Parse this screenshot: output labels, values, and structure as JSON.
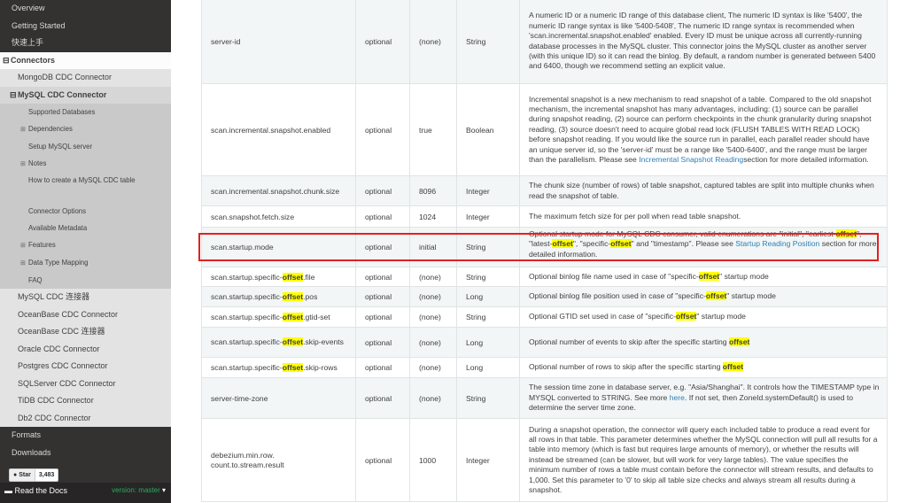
{
  "sidebar": {
    "top_items": [
      "Overview",
      "Getting Started",
      "快速上手"
    ],
    "section_label": "Connectors",
    "connector_mongodb": "MongoDB CDC Connector",
    "connector_mysql": "MySQL CDC Connector",
    "mysql_sub": [
      "Supported Databases",
      "Dependencies",
      "Setup MySQL server",
      "Notes",
      "How to create a MySQL CDC table",
      "Connector Options",
      "Available Metadata",
      "Features",
      "Data Type Mapping",
      "FAQ"
    ],
    "other_connectors": [
      "MySQL CDC 连接器",
      "OceanBase CDC Connector",
      "OceanBase CDC 连接器",
      "Oracle CDC Connector",
      "Postgres CDC Connector",
      "SQLServer CDC Connector",
      "TiDB CDC Connector",
      "Db2 CDC Connector"
    ],
    "bottom_items": [
      "Formats",
      "Downloads"
    ]
  },
  "github": {
    "star_label": "Star",
    "star_count": "3,483"
  },
  "rtd": {
    "label": "Read the Docs",
    "version": "version: master"
  },
  "options": {
    "server_id": {
      "name": "server-id",
      "required": "optional",
      "default": "(none)",
      "type": "String",
      "desc": "A numeric ID or a numeric ID range of this database client, The numeric ID syntax is like '5400', the numeric ID range syntax is like '5400-5408', The numeric ID range syntax is recommended when 'scan.incremental.snapshot.enabled' enabled. Every ID must be unique across all currently-running database processes in the MySQL cluster. This connector joins the MySQL cluster as another server (with this unique ID) so it can read the binlog. By default, a random number is generated between 5400 and 6400, though we recommend setting an explicit value."
    },
    "incremental_enabled": {
      "name": "scan.incremental.snapshot.enabled",
      "required": "optional",
      "default": "true",
      "type": "Boolean",
      "desc": "Incremental snapshot is a new mechanism to read snapshot of a table. Compared to the old snapshot mechanism, the incremental snapshot has many advantages, including: (1) source can be parallel during snapshot reading, (2) source can perform checkpoints in the chunk granularity during snapshot reading, (3) source doesn't need to acquire global read lock (FLUSH TABLES WITH READ LOCK) before snapshot reading. If you would like the source run in parallel, each parallel reader should have an unique server id, so the 'server-id' must be a range like '5400-6400', and the range must be larger than the parallelism. Please see ",
      "link": "Incremental Snapshot Reading",
      "desc_tail": "section for more detailed information."
    },
    "chunk_size": {
      "name": "scan.incremental.snapshot.chunk.size",
      "required": "optional",
      "default": "8096",
      "type": "Integer",
      "desc": "The chunk size (number of rows) of table snapshot, captured tables are split into multiple chunks when read the snapshot of table."
    },
    "fetch_size": {
      "name": "scan.snapshot.fetch.size",
      "required": "optional",
      "default": "1024",
      "type": "Integer",
      "desc": "The maximum fetch size for per poll when read table snapshot."
    },
    "startup_mode": {
      "name": "scan.startup.mode",
      "required": "optional",
      "default": "initial",
      "type": "String",
      "desc_p1": "Optional startup mode for MySQL CDC consumer, valid enumerations are \"initial\", \"earliest-",
      "kw": "offset",
      "desc_p2": "\", \"latest-",
      "desc_p3": "\", \"specific-",
      "desc_p4": "\" and \"timestamp\". Please see ",
      "link": "Startup Reading Position",
      "desc_tail": " section for more detailed information."
    },
    "specific_file": {
      "name_pre": "scan.startup.specific-",
      "kw": "offset",
      "name_post": ".file",
      "required": "optional",
      "default": "(none)",
      "type": "String",
      "desc_pre": "Optional binlog file name used in case of \"specific-",
      "desc_post": "\" startup mode"
    },
    "specific_pos": {
      "name_pre": "scan.startup.specific-",
      "kw": "offset",
      "name_post": ".pos",
      "required": "optional",
      "default": "(none)",
      "type": "Long",
      "desc_pre": "Optional binlog file position used in case of \"specific-",
      "desc_post": "\" startup mode"
    },
    "specific_gtid": {
      "name_pre": "scan.startup.specific-",
      "kw": "offset",
      "name_post": ".gtid-set",
      "required": "optional",
      "default": "(none)",
      "type": "String",
      "desc_pre": "Optional GTID set used in case of \"specific-",
      "desc_post": "\" startup mode"
    },
    "skip_events": {
      "name_pre": "scan.startup.specific-",
      "kw": "offset",
      "name_post": ".skip-events",
      "required": "optional",
      "default": "(none)",
      "type": "Long",
      "desc_pre": "Optional number of events to skip after the specific starting "
    },
    "skip_rows": {
      "name_pre": "scan.startup.specific-",
      "kw": "offset",
      "name_post": ".skip-rows",
      "required": "optional",
      "default": "(none)",
      "type": "Long",
      "desc_pre": "Optional number of rows to skip after the specific starting "
    },
    "time_zone": {
      "name": "server-time-zone",
      "required": "optional",
      "default": "(none)",
      "type": "String",
      "desc": "The session time zone in database server, e.g. \"Asia/Shanghai\". It controls how the TIMESTAMP type in MYSQL converted to STRING. See more ",
      "link": "here",
      "desc_tail": ". If not set, then ZoneId.systemDefault() is used to determine the server time zone."
    },
    "min_row": {
      "name": "debezium.min.row. count.to.stream.result",
      "required": "optional",
      "default": "1000",
      "type": "Integer",
      "desc": "During a snapshot operation, the connector will query each included table to produce a read event for all rows in that table. This parameter determines whether the MySQL connection will pull all results for a table into memory (which is fast but requires large amounts of memory), or whether the results will instead be streamed (can be slower, but will work for very large tables). The value specifies the minimum number of rows a table must contain before the connector will stream results, and defaults to 1,000. Set this parameter to '0' to skip all table size checks and always stream all results during a snapshot."
    }
  }
}
